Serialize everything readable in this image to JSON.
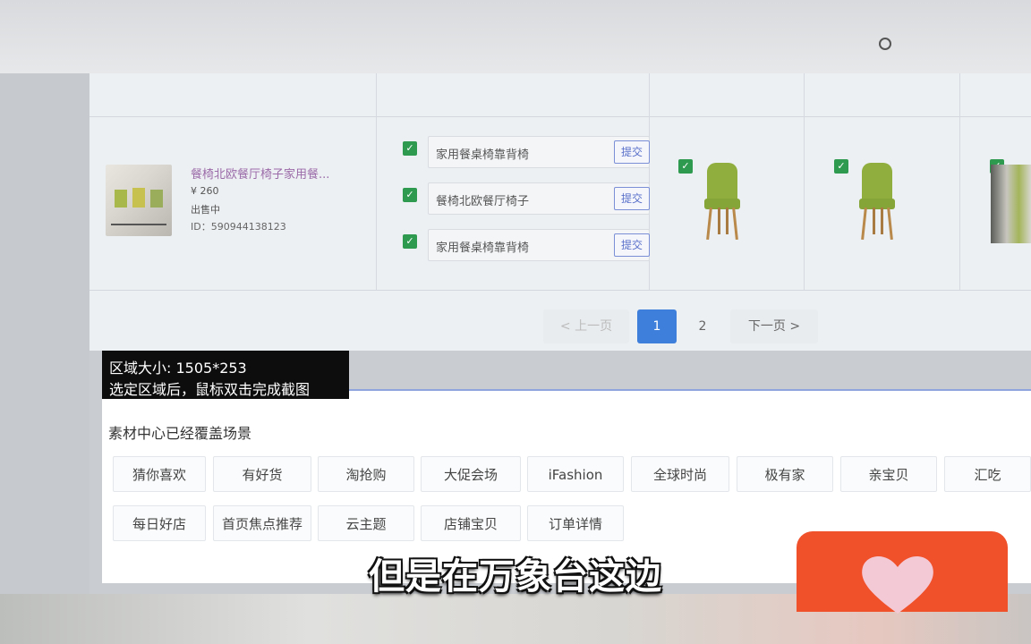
{
  "product": {
    "title": "餐椅北欧餐厅椅子家用餐...",
    "price": "¥ 260",
    "status": "出售中",
    "id": "ID：590944138123"
  },
  "tags": [
    {
      "text": "家用餐桌椅靠背椅",
      "checked": true,
      "button": "提交"
    },
    {
      "text": "餐椅北欧餐厅椅子",
      "checked": true,
      "button": "提交"
    },
    {
      "text": "家用餐桌椅靠背椅",
      "checked": true,
      "button": "提交"
    }
  ],
  "pagination": {
    "prev": "< 上一页",
    "pages": [
      "1",
      "2"
    ],
    "current": "1",
    "next": "下一页 >"
  },
  "screenshot_tool": {
    "size_label": "区域大小: 1505*253",
    "hint": "选定区域后，鼠标双击完成截图"
  },
  "scene_panel": {
    "title": "素材中心已经覆盖场景",
    "row1": [
      "猜你喜欢",
      "有好货",
      "淘抢购",
      "大促会场",
      "iFashion",
      "全球时尚",
      "极有家",
      "亲宝贝",
      "汇吃"
    ],
    "row2": [
      "每日好店",
      "首页焦点推荐",
      "云主题",
      "店铺宝贝",
      "订单详情"
    ]
  },
  "caption": "但是在万象台这边",
  "colors": {
    "accent": "#3e7fdb",
    "check": "#2e9a4f",
    "like_badge": "#f0502a",
    "product_link": "#9a6aa8"
  },
  "icons": [
    "search-icon",
    "check-icon",
    "chair-image",
    "heart-icon"
  ]
}
